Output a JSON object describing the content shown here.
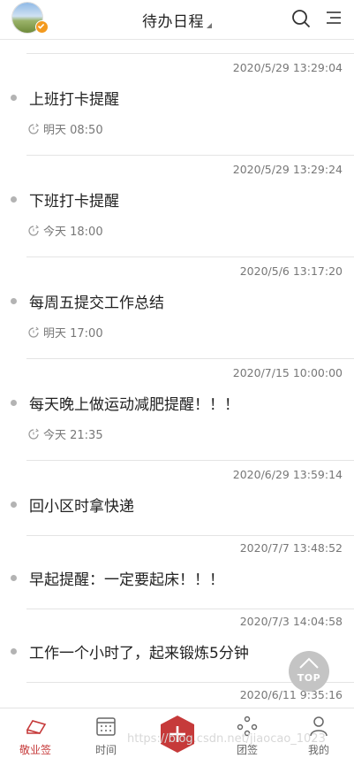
{
  "header": {
    "title": "待办日程",
    "avatar": "user-avatar",
    "icons": [
      "search-icon",
      "menu-icon"
    ]
  },
  "items": [
    {
      "timestamp": "2020/5/29 13:29:04",
      "title": "上班打卡提醒",
      "reminder": "明天 08:50"
    },
    {
      "timestamp": "2020/5/29 13:29:24",
      "title": "下班打卡提醒",
      "reminder": "今天 18:00"
    },
    {
      "timestamp": "2020/5/6 13:17:20",
      "title": "每周五提交工作总结",
      "reminder": "明天 17:00"
    },
    {
      "timestamp": "2020/7/15 10:00:00",
      "title": "每天晚上做运动减肥提醒！！！",
      "reminder": "今天 21:35"
    },
    {
      "timestamp": "2020/6/29 13:59:14",
      "title": "回小区时拿快递",
      "reminder": ""
    },
    {
      "timestamp": "2020/7/7 13:48:52",
      "title": "早起提醒：一定要起床！！！",
      "reminder": ""
    },
    {
      "timestamp": "2020/7/3 14:04:58",
      "title": "工作一个小时了，起来锻炼5分钟",
      "reminder": ""
    },
    {
      "timestamp": "2020/6/11 9:35:16",
      "title": "",
      "reminder": ""
    }
  ],
  "top_button": {
    "label": "TOP"
  },
  "tabbar": {
    "tabs": [
      {
        "label": "敬业签",
        "icon": "notebook-icon",
        "active": true
      },
      {
        "label": "时间",
        "icon": "calendar-icon",
        "active": false
      },
      {
        "label": "",
        "icon": "add-icon",
        "active": false
      },
      {
        "label": "团签",
        "icon": "team-icon",
        "active": false
      },
      {
        "label": "我的",
        "icon": "profile-icon",
        "active": false
      }
    ]
  },
  "watermark": "https://blog.csdn.net/jiaocao_1023",
  "colors": {
    "accent": "#c63a3a",
    "badge": "#f39a1f",
    "top_button": "#c4c4c4"
  }
}
